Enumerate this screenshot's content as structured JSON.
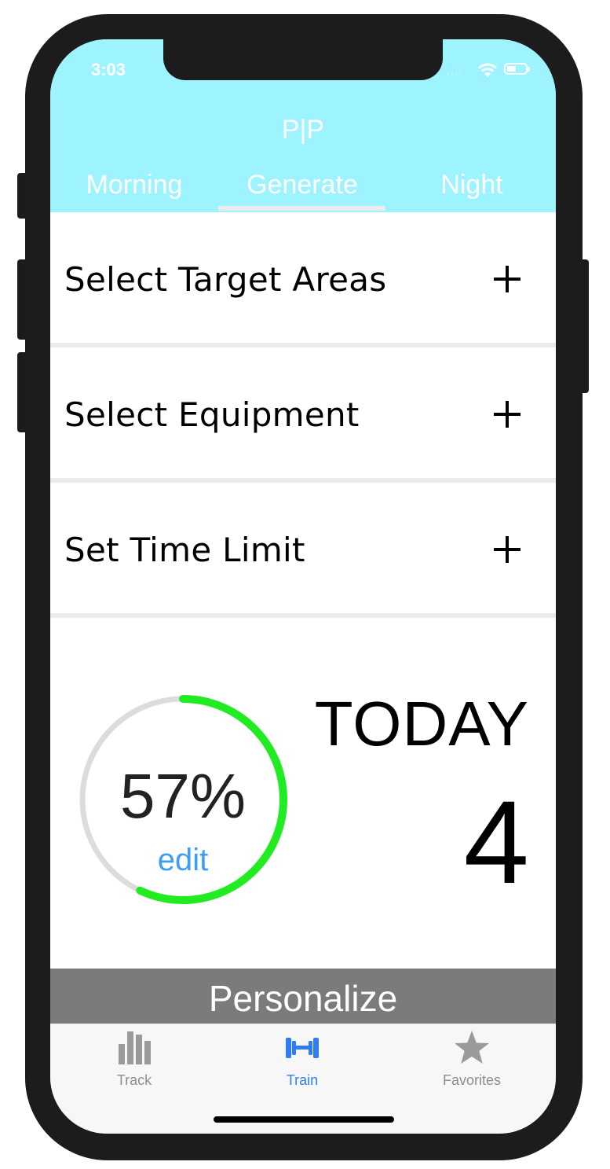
{
  "status_bar": {
    "time": "3:03",
    "signal_dots": "...."
  },
  "header": {
    "app_title": "P|P",
    "tabs": [
      {
        "label": "Morning"
      },
      {
        "label": "Generate"
      },
      {
        "label": "Night"
      }
    ],
    "selected_tab": "Generate",
    "background_color": "#9ef4fe"
  },
  "options": [
    {
      "label": "Select Target Areas",
      "icon": "plus-icon"
    },
    {
      "label": "Select Equipment",
      "icon": "plus-icon"
    },
    {
      "label": "Set Time Limit",
      "icon": "plus-icon"
    }
  ],
  "progress": {
    "percent_label": "57%",
    "percent_value": 57,
    "edit_label": "edit",
    "ring_color": "#21ec21",
    "track_color": "#dcdcdc"
  },
  "today": {
    "label": "TODAY",
    "count": "4"
  },
  "personalize_label": "Personalize",
  "tab_bar": {
    "items": [
      {
        "label": "Track",
        "icon": "bar-chart-icon"
      },
      {
        "label": "Train",
        "icon": "dumbbell-icon"
      },
      {
        "label": "Favorites",
        "icon": "star-icon"
      }
    ],
    "selected": "Train",
    "active_color": "#2f7cf6"
  }
}
